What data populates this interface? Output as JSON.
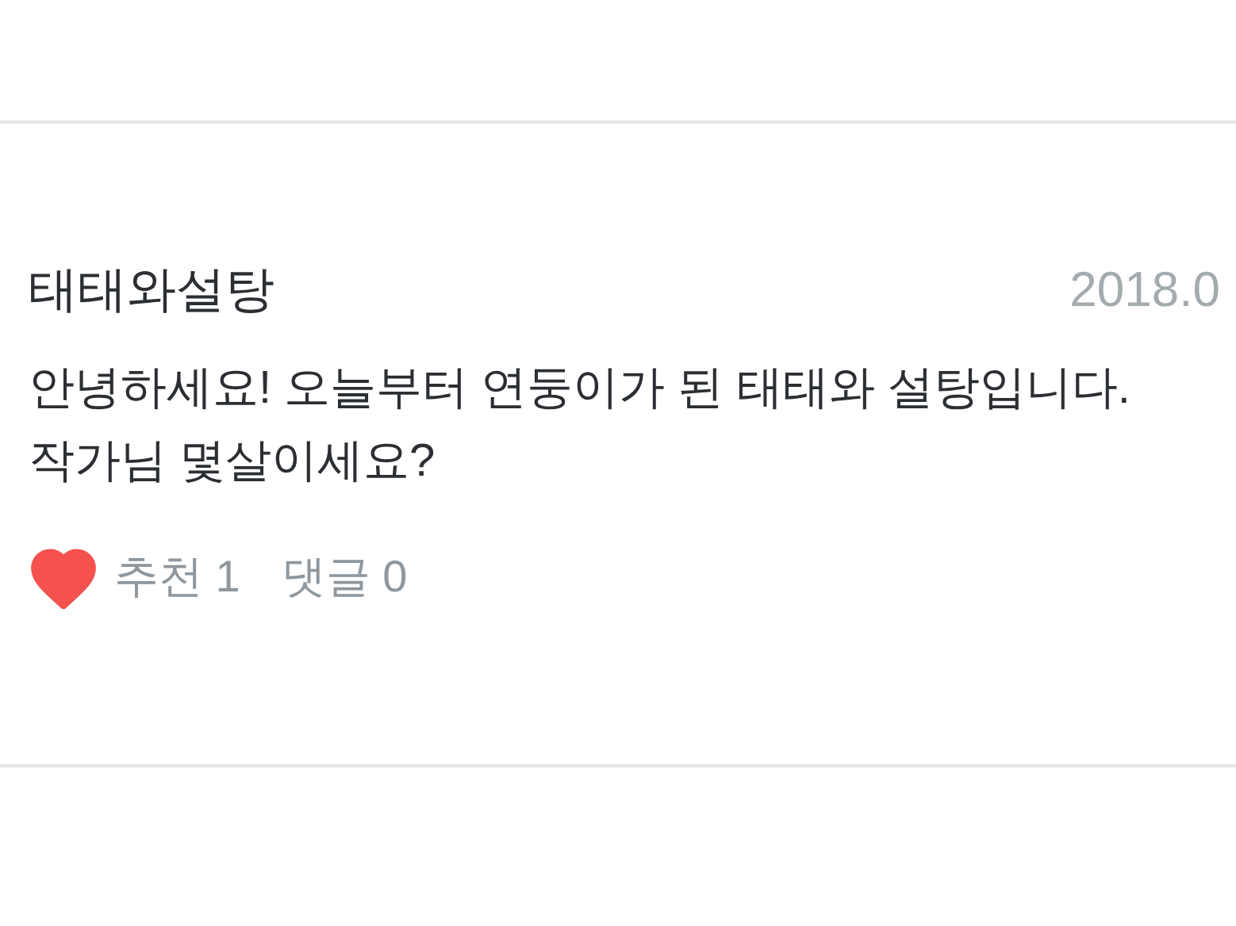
{
  "comment": {
    "author": "태태와설탕",
    "date": "2018.0",
    "body": "안녕하세요! 오늘부터 연둥이가 된 태태와 설탕입니다.\n작가님 몇살이세요?",
    "liked": true,
    "likes_label": "추천",
    "likes": "1",
    "replies_label": "댓글",
    "replies": "0"
  }
}
